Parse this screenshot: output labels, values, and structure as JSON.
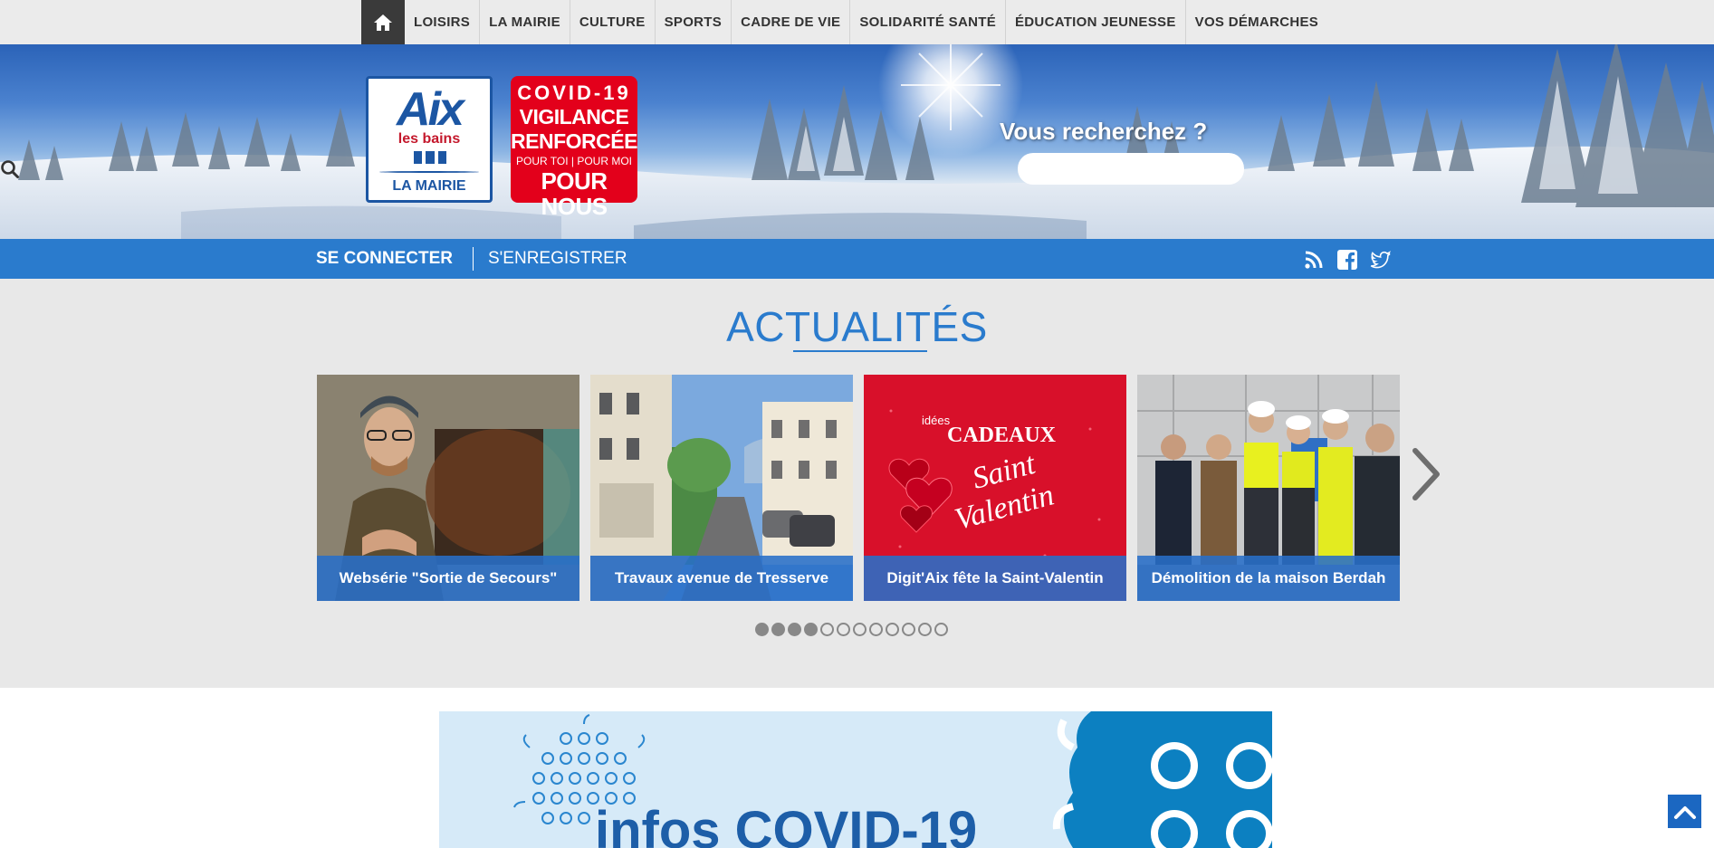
{
  "topnav": {
    "home_icon": "home-icon",
    "items": [
      "LOISIRS",
      "LA MAIRIE",
      "CULTURE",
      "SPORTS",
      "CADRE DE VIE",
      "SOLIDARITÉ SANTÉ",
      "ÉDUCATION JEUNESSE",
      "VOS DÉMARCHES"
    ]
  },
  "logo": {
    "aix": "Aix",
    "les_bains": "les bains",
    "mairie": "LA MAIRIE"
  },
  "covid_badge": {
    "title": "COVID-19",
    "line1": "VIGILANCE",
    "line2": "RENFORCÉE",
    "small": "POUR TOI | POUR MOI",
    "big": "POUR NOUS"
  },
  "search": {
    "label": "Vous recherchez ?",
    "placeholder": "",
    "icon": "search-icon"
  },
  "account": {
    "connect_label": "SE CONNECTER",
    "register_label": "S'ENREGISTRER",
    "social_icons": [
      "rss-icon",
      "facebook-icon",
      "twitter-icon"
    ]
  },
  "news": {
    "title": "ACTUALITÉS",
    "cards": [
      {
        "caption": "Websérie \"Sortie de Secours\""
      },
      {
        "caption": "Travaux avenue de Tresserve"
      },
      {
        "caption": "Digit'Aix fête la Saint-Valentin",
        "image_text": {
          "idees": "idées",
          "cadeaux": "CADEAUX",
          "saint": "Saint",
          "valentin": "Valentin"
        }
      },
      {
        "caption": "Démolition de la maison Berdah"
      }
    ],
    "next_icon": "chevron-right-icon",
    "dots_total": 12,
    "dots_active": 4
  },
  "covid_banner": {
    "text": "infos COVID-19"
  },
  "colors": {
    "accent_blue": "#2a7bcd",
    "covid_red": "#e3001b",
    "nav_bg": "#ebebeb"
  }
}
